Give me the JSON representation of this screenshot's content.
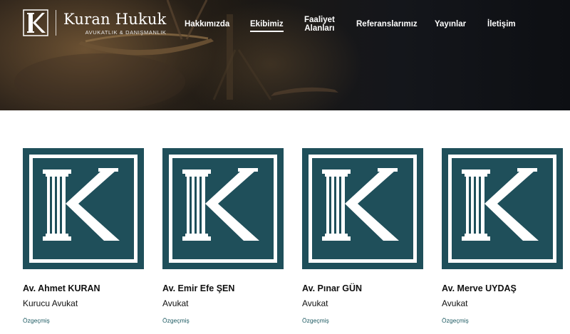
{
  "colors": {
    "brand_teal": "#1f4f5a",
    "link_teal": "#1d5a62",
    "header_text": "#ffffff",
    "body_text": "#111111"
  },
  "header": {
    "logo_letter": "K",
    "logo_title": "Kuran Hukuk",
    "logo_subtitle": "AVUKATLIK & DANIŞMANLIK",
    "background_icon": "scales-of-justice-icon"
  },
  "nav": {
    "items": [
      {
        "label": "Hakkımızda",
        "active": false
      },
      {
        "label": "Ekibimiz",
        "active": true
      },
      {
        "label_line1": "Faaliyet",
        "label_line2": "Alanları",
        "active": false
      },
      {
        "label": "Referanslarımız",
        "active": false
      },
      {
        "label": "Yayınlar",
        "active": false
      },
      {
        "label": "İletişim",
        "active": false
      }
    ]
  },
  "team": {
    "members": [
      {
        "name": "Av. Ahmet KURAN",
        "role": "Kurucu Avukat",
        "link": "Özgeçmiş",
        "photo_icon": "kuran-hukuk-k-logo-icon"
      },
      {
        "name": "Av. Emir Efe ŞEN",
        "role": "Avukat",
        "link": "Özgeçmiş",
        "photo_icon": "kuran-hukuk-k-logo-icon"
      },
      {
        "name": "Av. Pınar GÜN",
        "role": "Avukat",
        "link": "Özgeçmiş",
        "photo_icon": "kuran-hukuk-k-logo-icon"
      },
      {
        "name": "Av. Merve UYDAŞ",
        "role": "Avukat",
        "link": "Özgeçmiş",
        "photo_icon": "kuran-hukuk-k-logo-icon"
      }
    ]
  }
}
